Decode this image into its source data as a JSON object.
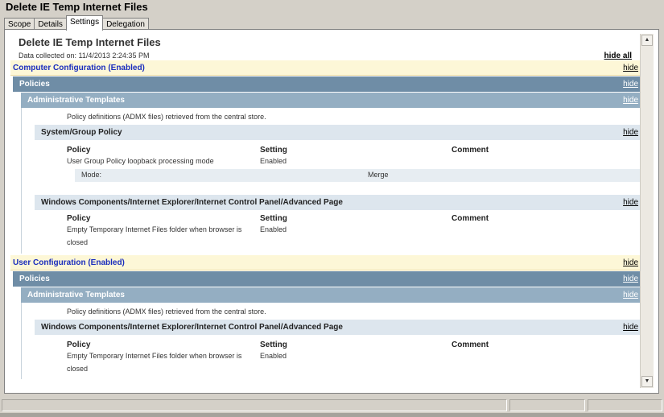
{
  "window": {
    "title": "Delete IE Temp Internet Files"
  },
  "tabs": [
    "Scope",
    "Details",
    "Settings",
    "Delegation"
  ],
  "report": {
    "title": "Delete IE Temp Internet Files",
    "collected": "Data collected on: 11/4/2013 2:24:35 PM",
    "hide_all": "hide all",
    "hide": "hide"
  },
  "computer": {
    "label": "Computer Configuration (Enabled)",
    "policies": "Policies",
    "admin": "Administrative Templates",
    "note": "Policy definitions (ADMX files) retrieved from the central store.",
    "system": {
      "label": "System/Group Policy",
      "headers": [
        "Policy",
        "Setting",
        "Comment"
      ],
      "policy": "User Group Policy loopback processing mode",
      "setting": "Enabled",
      "mode_label": "Mode:",
      "mode_value": "Merge"
    },
    "wincomp": {
      "label": "Windows Components/Internet Explorer/Internet Control Panel/Advanced Page",
      "headers": [
        "Policy",
        "Setting",
        "Comment"
      ],
      "policy_line1": "Empty Temporary Internet Files folder when browser is",
      "policy_line2": "closed",
      "setting": "Enabled"
    }
  },
  "user": {
    "label": "User Configuration (Enabled)",
    "policies": "Policies",
    "admin": "Administrative Templates",
    "note": "Policy definitions (ADMX files) retrieved from the central store.",
    "wincomp": {
      "label": "Windows Components/Internet Explorer/Internet Control Panel/Advanced Page",
      "headers": [
        "Policy",
        "Setting",
        "Comment"
      ],
      "policy_line1": "Empty Temporary Internet Files folder when browser is",
      "policy_line2": "closed",
      "setting": "Enabled"
    }
  },
  "icons": {
    "scroll_up": "up-arrow-icon",
    "scroll_down": "down-arrow-icon"
  },
  "colors": {
    "config_bg": "#fdf7d7",
    "config_text": "#1a2dbd",
    "policies_bg": "#6f8da6",
    "admin_bg": "#94aec2",
    "sub_bg": "#dde6ee"
  }
}
